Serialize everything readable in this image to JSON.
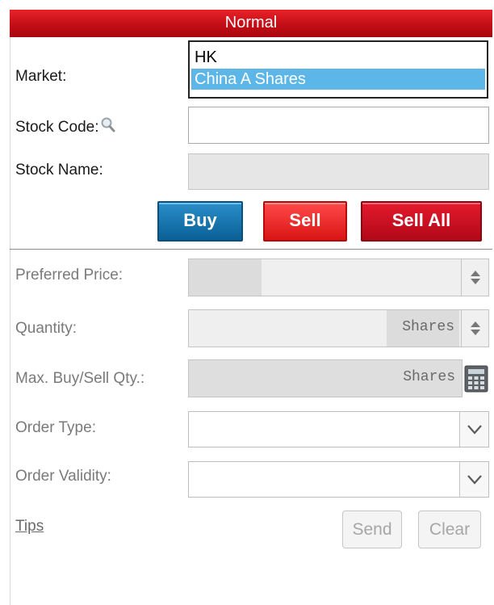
{
  "header": {
    "title": "Normal"
  },
  "market": {
    "label": "Market:",
    "options": [
      "HK",
      "China A Shares"
    ],
    "highlighted": "China A Shares"
  },
  "stock_code": {
    "label": "Stock Code:",
    "value": ""
  },
  "stock_name": {
    "label": "Stock Name:",
    "value": ""
  },
  "actions": {
    "buy": "Buy",
    "sell": "Sell",
    "sell_all": "Sell All"
  },
  "preferred_price": {
    "label": "Preferred Price:",
    "value": ""
  },
  "quantity": {
    "label": "Quantity:",
    "unit": "Shares",
    "value": ""
  },
  "max_qty": {
    "label": "Max. Buy/Sell Qty.:",
    "unit": "Shares"
  },
  "order_type": {
    "label": "Order Type:",
    "value": ""
  },
  "order_validity": {
    "label": "Order Validity:",
    "value": ""
  },
  "footer": {
    "tips": "Tips",
    "send": "Send",
    "clear": "Clear"
  },
  "colors": {
    "header_red": "#c40e16",
    "buy_blue": "#0a5f96",
    "sell_red": "#d91414",
    "highlight_blue": "#5cb6e8"
  }
}
